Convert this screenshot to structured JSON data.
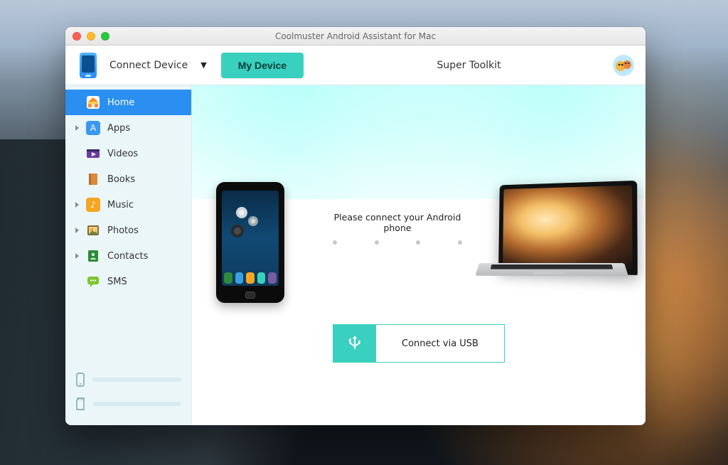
{
  "window": {
    "title": "Coolmuster Android Assistant for Mac"
  },
  "toolbar": {
    "connect_label": "Connect Device",
    "my_device_label": "My Device",
    "super_toolkit_label": "Super Toolkit"
  },
  "sidebar": {
    "items": [
      {
        "label": "Home",
        "icon": "home-icon",
        "active": true,
        "hasChildren": false
      },
      {
        "label": "Apps",
        "icon": "apps-icon",
        "active": false,
        "hasChildren": true
      },
      {
        "label": "Videos",
        "icon": "videos-icon",
        "active": false,
        "hasChildren": false
      },
      {
        "label": "Books",
        "icon": "books-icon",
        "active": false,
        "hasChildren": false
      },
      {
        "label": "Music",
        "icon": "music-icon",
        "active": false,
        "hasChildren": true
      },
      {
        "label": "Photos",
        "icon": "photos-icon",
        "active": false,
        "hasChildren": true
      },
      {
        "label": "Contacts",
        "icon": "contacts-icon",
        "active": false,
        "hasChildren": true
      },
      {
        "label": "SMS",
        "icon": "sms-icon",
        "active": false,
        "hasChildren": false
      }
    ]
  },
  "main": {
    "prompt_text": "Please connect your Android phone",
    "connect_button_label": "Connect via USB"
  },
  "colors": {
    "accent": "#3ad0bf",
    "primary_blue": "#2a8ff0"
  }
}
